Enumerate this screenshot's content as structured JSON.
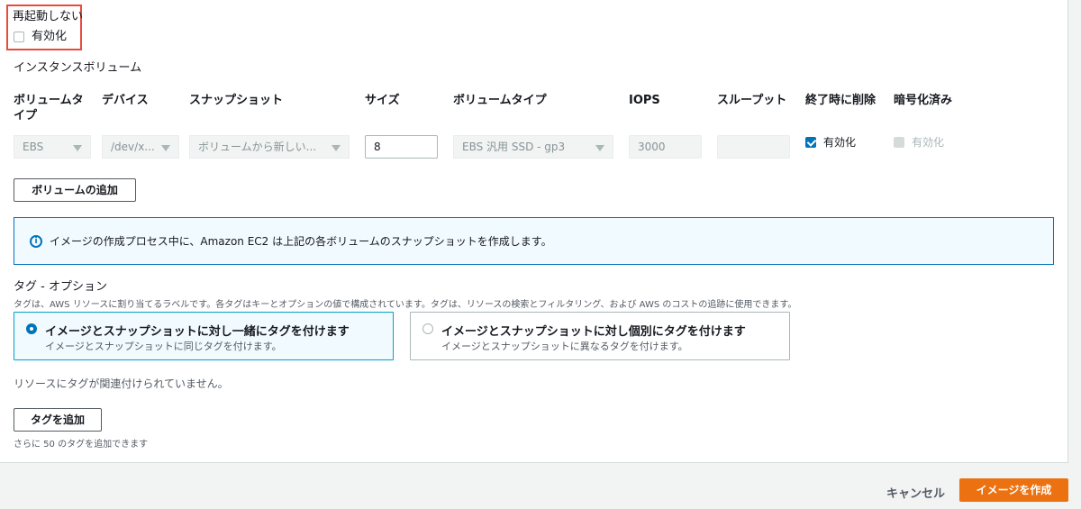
{
  "reboot": {
    "label": "再起動しない",
    "checkbox_label": "有効化",
    "checked": false
  },
  "volumes": {
    "section_title": "インスタンスボリューム",
    "columns": {
      "volume_type": [
        "ボリュームタ",
        "イプ"
      ],
      "device": "デバイス",
      "snapshot": "スナップショット",
      "size": "サイズ",
      "ebs_volume_type": "ボリュームタイプ",
      "iops": "IOPS",
      "throughput": "スループット",
      "delete_on_termination": "終了時に削除",
      "encrypted": "暗号化済み"
    },
    "row": {
      "volume_type": "EBS",
      "device": "/dev/x...",
      "snapshot": "ボリュームから新しい...",
      "size": "8",
      "ebs_volume_type": "EBS 汎用 SSD - gp3",
      "iops": "3000",
      "throughput": "",
      "delete_on_termination_label": "有効化",
      "delete_on_termination": true,
      "encrypted_label": "有効化",
      "encrypted": false
    },
    "add_button": "ボリュームの追加"
  },
  "info": {
    "icon": "info-icon",
    "text": "イメージの作成プロセス中に、Amazon EC2 は上記の各ボリュームのスナップショットを作成します。"
  },
  "tags": {
    "title": "タグ - オプション",
    "description": "タグは、AWS リソースに割り当てるラベルです。各タグはキーとオプションの値で構成されています。タグは、リソースの検索とフィルタリング、および AWS のコストの追跡に使用できます。",
    "options": [
      {
        "title": "イメージとスナップショットに対し一緒にタグを付けます",
        "description": "イメージとスナップショットに同じタグを付けます。",
        "selected": true
      },
      {
        "title": "イメージとスナップショットに対し個別にタグを付けます",
        "description": "イメージとスナップショットに異なるタグを付けます。",
        "selected": false
      }
    ],
    "empty_text": "リソースにタグが関連付けられていません。",
    "add_button": "タグを追加",
    "remaining_text": "さらに 50 のタグを追加できます"
  },
  "footer": {
    "cancel": "キャンセル",
    "create": "イメージを作成"
  },
  "colors": {
    "primary": "#ec7211",
    "accent": "#0073bb",
    "highlight": "#e74c3c"
  }
}
